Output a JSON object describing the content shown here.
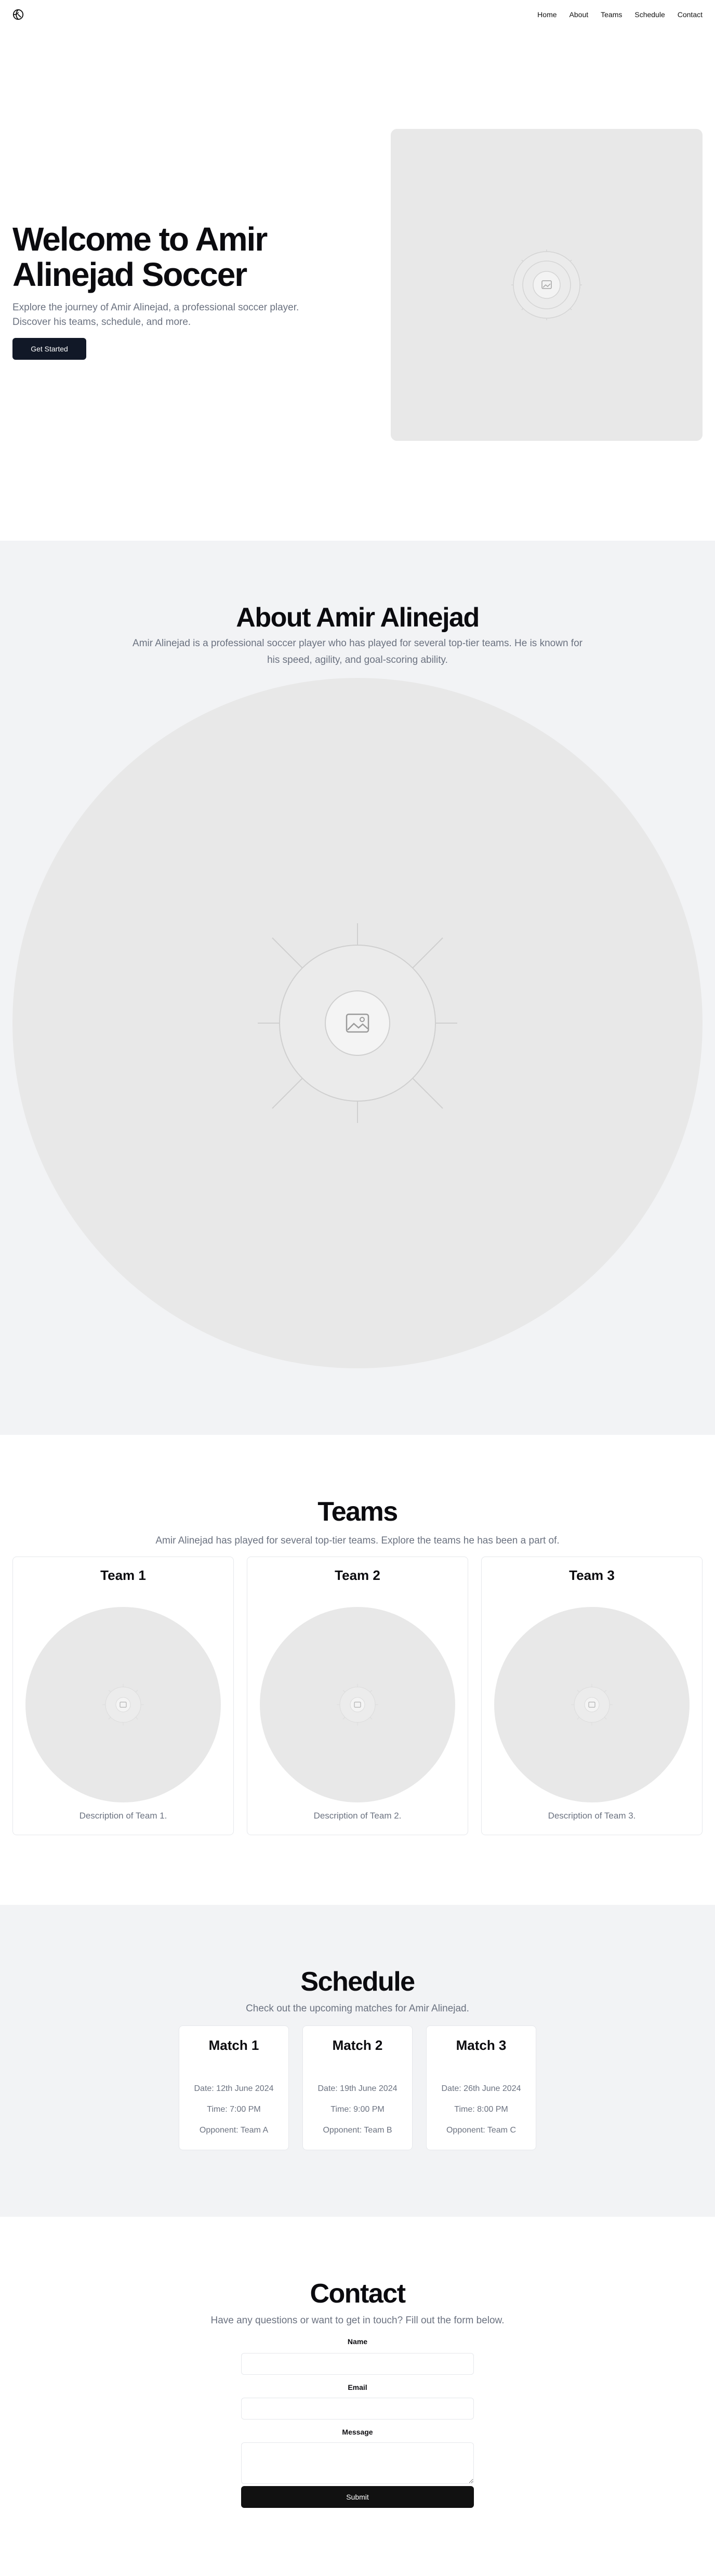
{
  "nav": {
    "logo_icon": "soccer-ball-icon",
    "items": [
      "Home",
      "About",
      "Teams",
      "Schedule",
      "Contact"
    ]
  },
  "hero": {
    "title": "Welcome to Amir Alinejad Soccer",
    "subtitle": "Explore the journey of Amir Alinejad, a professional soccer player. Discover his teams, schedule, and more.",
    "cta": "Get Started",
    "image_icon": "image-placeholder-icon"
  },
  "about": {
    "title": "About Amir Alinejad",
    "text": "Amir Alinejad is a professional soccer player who has played for several top-tier teams. He is known for his speed, agility, and goal-scoring ability.",
    "image_icon": "image-placeholder-icon"
  },
  "teams": {
    "title": "Teams",
    "subtitle": "Amir Alinejad has played for several top-tier teams. Explore the teams he has been a part of.",
    "cards": [
      {
        "name": "Team 1",
        "description": "Description of Team 1."
      },
      {
        "name": "Team 2",
        "description": "Description of Team 2."
      },
      {
        "name": "Team 3",
        "description": "Description of Team 3."
      }
    ]
  },
  "schedule": {
    "title": "Schedule",
    "subtitle": "Check out the upcoming matches for Amir Alinejad.",
    "matches": [
      {
        "name": "Match 1",
        "date": "Date: 12th June 2024",
        "time": "Time: 7:00 PM",
        "opponent": "Opponent: Team A"
      },
      {
        "name": "Match 2",
        "date": "Date: 19th June 2024",
        "time": "Time: 9:00 PM",
        "opponent": "Opponent: Team B"
      },
      {
        "name": "Match 3",
        "date": "Date: 26th June 2024",
        "time": "Time: 8:00 PM",
        "opponent": "Opponent: Team C"
      }
    ]
  },
  "contact": {
    "title": "Contact",
    "subtitle": "Have any questions or want to get in touch? Fill out the form below.",
    "name_label": "Name",
    "email_label": "Email",
    "message_label": "Message",
    "submit": "Submit"
  },
  "colors": {
    "primary_button": "#111827",
    "placeholder_bg": "#e8e8e8",
    "section_alt_bg": "#f2f3f5",
    "muted_text": "#6b7280"
  }
}
